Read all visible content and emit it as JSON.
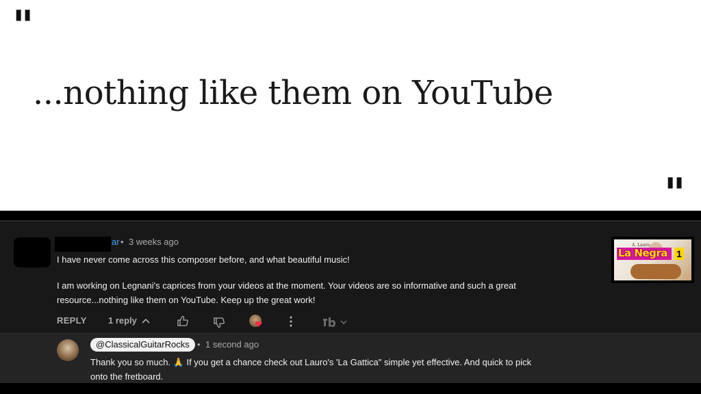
{
  "quote": {
    "open_mark": "\"",
    "close_mark": "\"",
    "text": "...nothing like them on YouTube"
  },
  "comment": {
    "name_visible_fragment": "ar",
    "time": "3 weeks ago",
    "lines": [
      "I have never come across this composer before, and what beautiful music!",
      "",
      "I am working on Legnani's caprices from your videos at the moment. Your videos are so informative and such a great",
      "resource...nothing like them on YouTube. Keep up the great work!"
    ],
    "actions": {
      "reply_label": "REPLY",
      "reply_count": "1 reply",
      "icons": [
        "chevron-up-icon",
        "thumbs-up-icon",
        "thumbs-down-icon",
        "creator-heart-icon",
        "more-vert-icon",
        "tubebuddy-icon",
        "chevron-down-icon"
      ]
    }
  },
  "thumbnail": {
    "author": "A. Lauro",
    "title": "La Negra",
    "number": "1"
  },
  "reply": {
    "handle": "@ClassicalGuitarRocks",
    "time": "1 second ago",
    "line1": "Thank you so much. 🙏 If you get a chance check out Lauro's 'La Gattica\" simple yet effective. And quick to pick",
    "line2": "onto the fretboard."
  },
  "colors": {
    "panel_bg": "#181818",
    "reply_bg": "#242424",
    "link_blue": "#3ea6ff",
    "muted": "#aaaaaa",
    "text": "#f1f1f1"
  }
}
